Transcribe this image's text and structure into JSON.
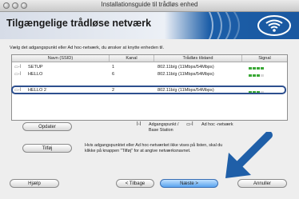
{
  "window": {
    "title": "Installationsguide til trådløs enhed"
  },
  "header": {
    "title": "Tilgængelige trådløse netværk"
  },
  "instruction": "Vælg det adgangspunkt eller Ad hoc-netværk, du ønsker at knytte enheden til.",
  "table": {
    "columns": [
      "Navn (SSID)",
      "Kanal",
      "Trådløs tilstand",
      "Signal"
    ],
    "rows": [
      {
        "name": "SETUP",
        "channel": "1",
        "mode": "802.11b/g (11Mbps/54Mbps)",
        "signal": 4,
        "selected": false
      },
      {
        "name": "HELLO",
        "channel": "6",
        "mode": "802.11b/g (11Mbps/54Mbps)",
        "signal": 3,
        "selected": false
      },
      {
        "name": "HELLO 2",
        "channel": "2",
        "mode": "802.11b/g (11Mbps/54Mbps)",
        "signal": 3,
        "selected": true
      }
    ]
  },
  "legend": {
    "access_point": "Adgangspunkt /",
    "base_station": "Base Station",
    "adhoc": "Ad hoc -netværk"
  },
  "buttons": {
    "refresh": "Opdater",
    "add": "Tilføj",
    "help": "Hjælp",
    "back": "< Tilbage",
    "next": "Næste >",
    "cancel": "Annuller"
  },
  "add_help_text": {
    "line1": "Hvis adgangspunktet eller Ad hoc-netværket ikke vises på listen, skal du",
    "line2": "klikke på knappen \"Tilføj\" for at angive netværksnavnet."
  },
  "colors": {
    "header_blue": "#1a58a0",
    "selection": "#2d4f8e",
    "arrow": "#1f5fa8",
    "signal": "#3aa836"
  }
}
